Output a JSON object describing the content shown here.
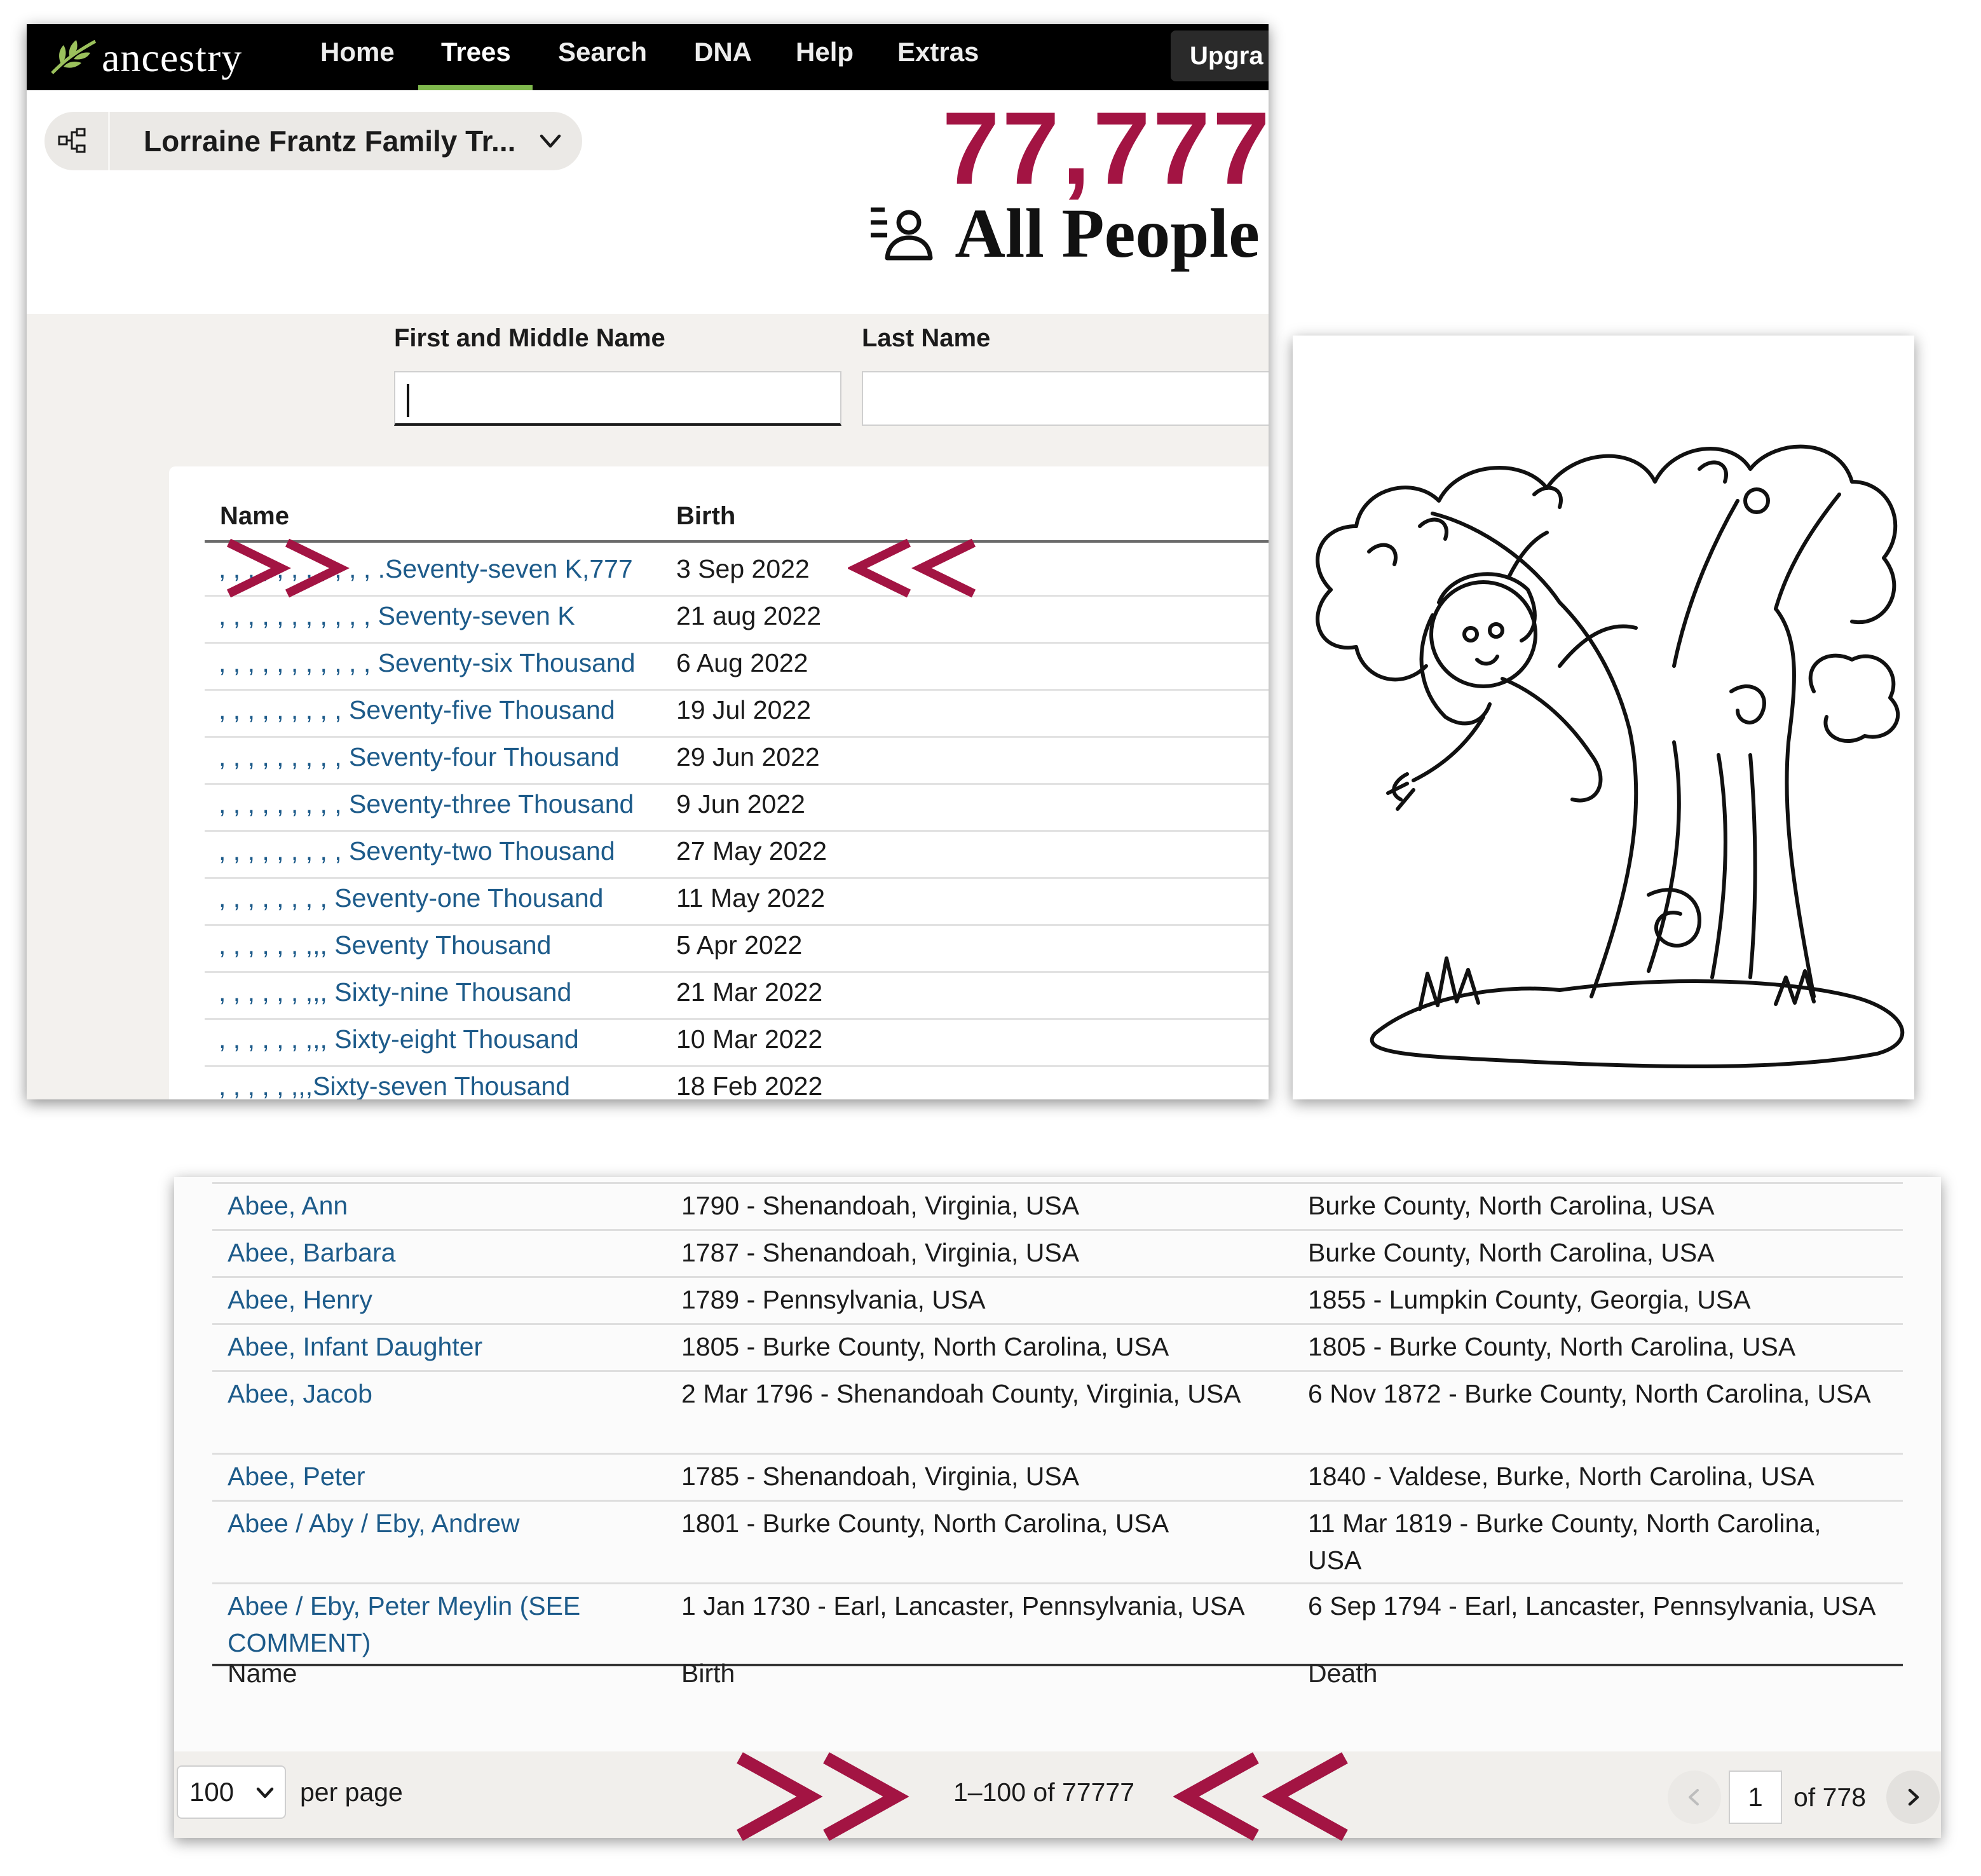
{
  "nav": {
    "logo_text": "ancestry",
    "items": [
      "Home",
      "Trees",
      "Search",
      "DNA",
      "Help",
      "Extras"
    ],
    "active": "Trees",
    "upgrade_label": "Upgra"
  },
  "tree_selector": {
    "label": "Lorraine Frantz Family Tr...",
    "icon": "tree-structure-icon"
  },
  "headline": {
    "count": "77,777",
    "label": "All People",
    "icon": "people-list-icon"
  },
  "filters": {
    "first_middle_label": "First and Middle Name",
    "last_label": "Last Name",
    "first_middle_value": "",
    "last_value": ""
  },
  "results": {
    "columns": [
      "Name",
      "Birth"
    ],
    "rows": [
      {
        "name": ", , , , , , , , , , , .Seventy-seven K,777",
        "birth": "3 Sep 2022"
      },
      {
        "name": ", , , , , , , , , , , Seventy-seven K",
        "birth": "21 aug 2022"
      },
      {
        "name": ", , , , , , , , , , , Seventy-six Thousand",
        "birth": "6 Aug 2022"
      },
      {
        "name": ", , , , , , , , , Seventy-five Thousand",
        "birth": "19 Jul 2022"
      },
      {
        "name": ", , , , , , , , , Seventy-four Thousand",
        "birth": "29 Jun 2022"
      },
      {
        "name": ", , , , , , , , , Seventy-three Thousand",
        "birth": "9 Jun 2022"
      },
      {
        "name": ", , , , , , , , , Seventy-two Thousand",
        "birth": "27 May 2022"
      },
      {
        "name": ", , , , , , , , Seventy-one Thousand",
        "birth": "11 May 2022"
      },
      {
        "name": ", , , , , , ,,, Seventy Thousand",
        "birth": "5 Apr 2022"
      },
      {
        "name": ", , , , , , ,,, Sixty-nine Thousand",
        "birth": "21 Mar 2022"
      },
      {
        "name": ", , , , , , ,,, Sixty-eight Thousand",
        "birth": "10 Mar 2022"
      },
      {
        "name": ", , , , , ,,,Sixty-seven Thousand",
        "birth": "18 Feb 2022"
      }
    ]
  },
  "table2": {
    "rows": [
      {
        "name": "Abee, Ann",
        "birth": "1790 - Shenandoah, Virginia, USA",
        "death": "Burke County, North Carolina, USA"
      },
      {
        "name": "Abee, Barbara",
        "birth": "1787 - Shenandoah, Virginia, USA",
        "death": "Burke County, North Carolina, USA"
      },
      {
        "name": "Abee, Henry",
        "birth": "1789 - Pennsylvania, USA",
        "death": "1855 - Lumpkin County, Georgia, USA"
      },
      {
        "name": "Abee, Infant Daughter",
        "birth": "1805 - Burke County, North Carolina, USA",
        "death": "1805 - Burke County, North Carolina, USA"
      },
      {
        "name": "Abee, Jacob",
        "birth": "2 Mar 1796 - Shenandoah County, Virginia, USA",
        "death": "6 Nov 1872 - Burke County, North Carolina, USA"
      },
      {
        "name": "Abee, Peter",
        "birth": "1785 - Shenandoah, Virginia, USA",
        "death": "1840 - Valdese, Burke, North Carolina, USA"
      },
      {
        "name": "Abee / Aby / Eby, Andrew",
        "birth": "1801 - Burke County, North Carolina, USA",
        "death": "11 Mar 1819 - Burke County, North Carolina, USA"
      },
      {
        "name": "Abee / Eby, Peter Meylin (SEE COMMENT)",
        "birth": "1 Jan 1730 - Earl, Lancaster, Pennsylvania, USA",
        "death": "6 Sep 1794 - Earl, Lancaster, Pennsylvania, USA"
      }
    ],
    "footer": [
      "Name",
      "Birth",
      "Death"
    ]
  },
  "pager": {
    "per_page_value": "100",
    "per_page_label": "per page",
    "range": "1–100 of 77777",
    "current_page": "1",
    "total_pages_label": "of 778"
  },
  "colors": {
    "accent": "#a31443",
    "link": "#1d5b8a",
    "nav_active": "#7fb84d",
    "nav_bg": "#000000"
  }
}
